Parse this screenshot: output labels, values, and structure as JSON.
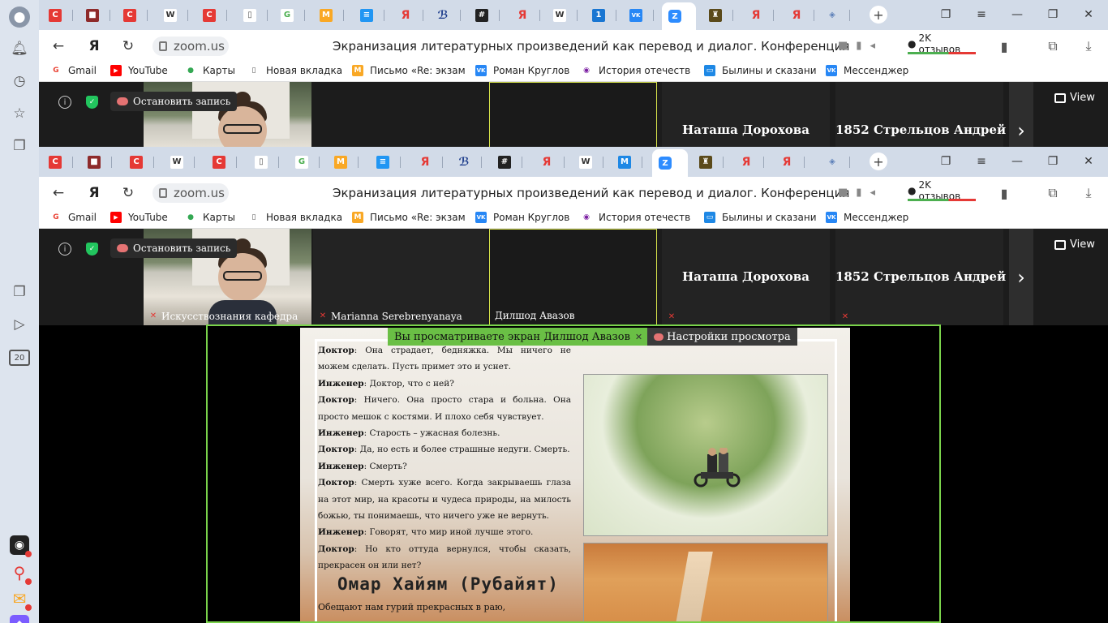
{
  "browser": {
    "tabs": [
      {
        "icon": "C",
        "color": "#e53935"
      },
      {
        "icon": "■",
        "color": "#8e2a2a"
      },
      {
        "icon": "C",
        "color": "#e53935"
      },
      {
        "icon": "W",
        "color": "#555555"
      },
      {
        "icon": "C",
        "color": "#e53935"
      },
      {
        "icon": "▯",
        "color": "#777777"
      },
      {
        "icon": "G",
        "color": "#4caf50"
      },
      {
        "icon": "M",
        "color": "#f9a825"
      },
      {
        "icon": "≡",
        "color": "#2196f3"
      },
      {
        "icon": "Я",
        "color": "#e53935"
      },
      {
        "icon": "ℬ",
        "color": "#1a3a8a"
      },
      {
        "icon": "#",
        "color": "#222222"
      },
      {
        "icon": "Я",
        "color": "#e53935"
      },
      {
        "icon": "W",
        "color": "#555555"
      },
      {
        "icon": "1",
        "color": "#1976d2"
      },
      {
        "icon": "VK",
        "color": "#2787f5"
      },
      {
        "icon": "Z",
        "color": "#2d8cff"
      },
      {
        "icon": "♜",
        "color": "#5b4a1a"
      },
      {
        "icon": "Я",
        "color": "#e53935"
      },
      {
        "icon": "Я",
        "color": "#e53935"
      },
      {
        "icon": "◈",
        "color": "#5c7fb8"
      }
    ],
    "url": "zoom.us",
    "page_title": "Экранизация литературных произведений как перевод и диалог. Конференция",
    "reviews": "2K отзывов",
    "bookmarks": [
      {
        "label": "Gmail",
        "icon": "G",
        "color": "#ea4335"
      },
      {
        "label": "YouTube",
        "icon": "▶",
        "color": "#ff0000"
      },
      {
        "label": "Карты",
        "icon": "●",
        "color": "#34a853"
      },
      {
        "label": "Новая вкладка",
        "icon": "▯",
        "color": "#777777"
      },
      {
        "label": "Письмо «Re: экзам",
        "icon": "M",
        "color": "#f9a825"
      },
      {
        "label": "Роман Круглов",
        "icon": "VK",
        "color": "#2787f5"
      },
      {
        "label": "История отечеств",
        "icon": "◉",
        "color": "#7b1fa2"
      },
      {
        "label": "Былины и сказани",
        "icon": "▭",
        "color": "#1e88e5"
      },
      {
        "label": "Мессенджер",
        "icon": "VK",
        "color": "#2787f5"
      }
    ]
  },
  "zoom": {
    "record_label": "Остановить запись",
    "view_label": "View",
    "participants": [
      {
        "name": "Искусствознания кафедра"
      },
      {
        "name": "Marianna Serebrenyanaya"
      },
      {
        "name": "Дилшод Авазов"
      },
      {
        "name": "Наташа Дорохова"
      },
      {
        "name": "1852 Стрельцов Андрей"
      }
    ],
    "share_notice": "Вы просматриваете экран Дилшод Авазов",
    "view_settings": "Настройки просмотра"
  },
  "document": {
    "lines": [
      {
        "speaker": "Доктор",
        "text": ": Она страдает, бедняжка. Мы ничего не можем сделать. Пусть примет это и уснет."
      },
      {
        "speaker": "Инженер",
        "text": ": Доктор, что с ней?"
      },
      {
        "speaker": "Доктор",
        "text": ": Ничего. Она просто стара и больна. Она просто мешок с костями. И плохо себя чувствует."
      },
      {
        "speaker": "Инженер",
        "text": ": Старость – ужасная болезнь."
      },
      {
        "speaker": "Доктор",
        "text": ": Да, но есть и более страшные недуги. Смерть."
      },
      {
        "speaker": "Инженер",
        "text": ": Смерть?"
      },
      {
        "speaker": "Доктор",
        "text": ": Смерть хуже всего. Когда закрываешь глаза на этот мир, на красоты и чудеса природы, на милость божью, ты понимаешь, что ничего уже не вернуть."
      },
      {
        "speaker": "Инженер",
        "text": ": Говорят, что мир иной лучше этого."
      },
      {
        "speaker": "Доктор",
        "text": ": Но кто оттуда вернулся, чтобы сказать, прекрасен он или нет?"
      }
    ],
    "heading": "Омар Хайям (Рубайят)",
    "footer": "Обещают нам гурий прекрасных в раю,"
  },
  "rail": {
    "badge": "20"
  }
}
